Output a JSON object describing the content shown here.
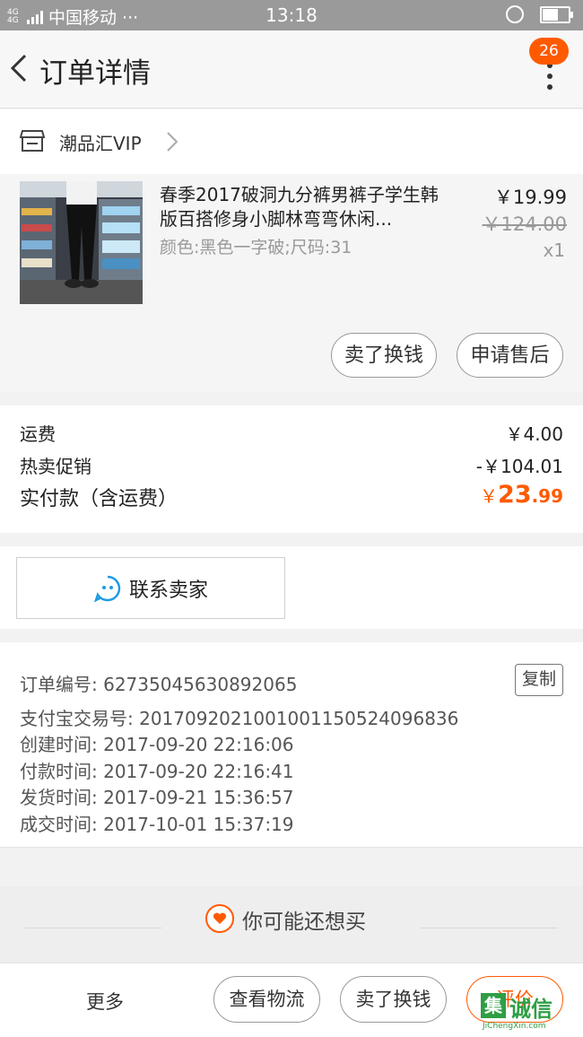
{
  "status_bar": {
    "network": "4G 4G",
    "carrier": "中国移动 ···",
    "time": "13:18",
    "battery_level": 0.55
  },
  "nav": {
    "title": "订单详情",
    "badge_count": "26"
  },
  "shop": {
    "name": "潮品汇VIP"
  },
  "product": {
    "title": "春季2017破洞九分裤男裤子学生韩版百搭修身小脚林弯弯休闲...",
    "sku": "颜色:黑色一字破;尺码:31",
    "price": "￥19.99",
    "original_price": "￥124.00",
    "quantity": "x1",
    "actions": [
      "卖了换钱",
      "申请售后"
    ]
  },
  "fees": {
    "shipping_label": "运费",
    "shipping_value": "￥4.00",
    "promo_label": "热卖促销",
    "promo_value": "-￥104.01",
    "total_label": "实付款（含运费）",
    "total_currency": "￥",
    "total_int": "23",
    "total_dec": ".99"
  },
  "contact": {
    "label": "联系卖家"
  },
  "order_info": {
    "order_no": "订单编号: 62735045630892065",
    "copy_label": "复制",
    "alipay_no": "支付宝交易号: 2017092021001001150524096836",
    "created": "创建时间: 2017-09-20 22:16:06",
    "paid": "付款时间: 2017-09-20 22:16:41",
    "shipped": "发货时间: 2017-09-21 15:36:57",
    "completed": "成交时间: 2017-10-01 15:37:19"
  },
  "recommend": {
    "label": "你可能还想买"
  },
  "bottom_bar": {
    "more": "更多",
    "logistics": "查看物流",
    "sell": "卖了换钱",
    "review": "评价"
  },
  "watermark": {
    "box_char": "集",
    "cn": "诚信",
    "en": "JiChengXin.com"
  },
  "colors": {
    "accent": "#ff5a00",
    "status_bar": "#9a9a9a",
    "watermark": "#2f9e44"
  }
}
